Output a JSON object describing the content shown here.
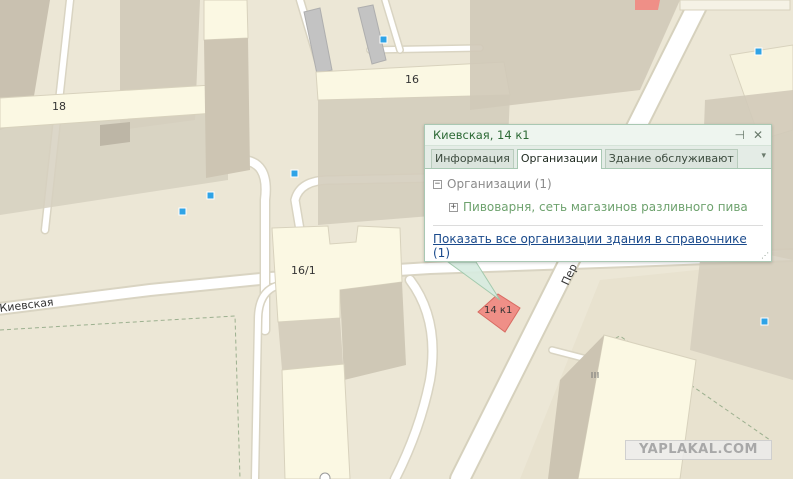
{
  "map": {
    "building_labels": {
      "b18": "18",
      "b16": "16",
      "b16_1": "16/1",
      "b14k1": "14 к1"
    },
    "street_labels": {
      "kievskaya": "Киевская",
      "per": "Пер"
    },
    "colors": {
      "background": "#ede8d8",
      "road": "#ffffff",
      "roof": "#fbf8e3",
      "selected_building": "#ef8f87",
      "poi_marker": "#2fa3e6"
    }
  },
  "popup": {
    "title": "Киевская, 14 к1",
    "pin_icon": "pin-icon",
    "close_icon": "close-icon",
    "tabs": [
      {
        "label": "Информация",
        "active": false
      },
      {
        "label": "Организации",
        "active": true
      },
      {
        "label": "Здание обслуживают",
        "active": false
      }
    ],
    "section": {
      "toggle": "⊟",
      "label": "Организации (1)",
      "items": [
        {
          "toggle": "⊞",
          "label": "Пивоварня, сеть магазинов разливного пива"
        }
      ]
    },
    "all_link": {
      "label": "Показать все организации здания в справочнике",
      "count": "(1)"
    }
  },
  "watermark": "YAPLAKAL.COM"
}
